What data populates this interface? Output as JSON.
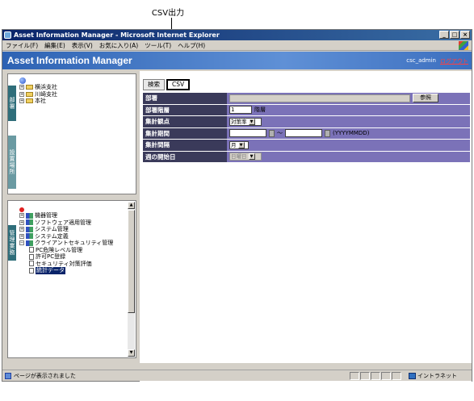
{
  "callout": {
    "label": "CSV出力"
  },
  "window": {
    "title": "Asset Information Manager - Microsoft Internet Explorer",
    "controls": [
      "_",
      "□",
      "×"
    ]
  },
  "menu": [
    "ファイル(F)",
    "編集(E)",
    "表示(V)",
    "お気に入り(A)",
    "ツール(T)",
    "ヘルプ(H)"
  ],
  "app": {
    "title": "Asset Information Manager",
    "user": "csc_admin",
    "logout": "ログアウト"
  },
  "left": {
    "tab_top": "部署",
    "tab_mid": "設置場所",
    "tab_bottom": "管理業務",
    "org_tree": {
      "branches": [
        "横浜支社",
        "川崎支社",
        "本社"
      ]
    },
    "task_tree": {
      "modules": [
        "機器管理",
        "ソフトウェア適用管理",
        "システム管理",
        "システム定義",
        "クライアントセキュリティ管理"
      ],
      "children": [
        "PC危険レベル管理",
        "許可PC登録",
        "セキュリティ対策評価",
        "統計データ"
      ]
    }
  },
  "main": {
    "tabs": [
      "検索",
      "CSV"
    ],
    "form": {
      "dept_label": "部署",
      "dept_browse": "参照",
      "level_label": "部署階層",
      "level_value": "1",
      "level_unit": "階層",
      "viewpoint_label": "集計観点",
      "viewpoint_value": "対策率",
      "period_label": "集計期間",
      "period_sep": "～",
      "period_hint": "(YYYYMMDD)",
      "interval_label": "集計間隔",
      "interval_value": "月",
      "weekstart_label": "週の開始日",
      "weekstart_value": "日曜日"
    }
  },
  "status": {
    "text": "ページが表示されました",
    "zone": "イントラネット"
  }
}
